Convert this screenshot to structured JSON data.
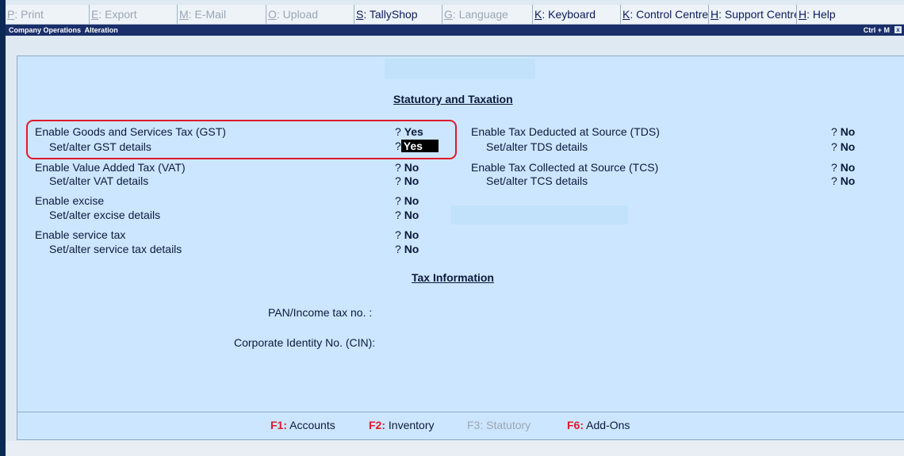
{
  "menu": [
    {
      "key": "P",
      "label": ": Print",
      "active": false
    },
    {
      "key": "E",
      "label": ": Export",
      "active": false
    },
    {
      "key": "M",
      "label": ": E-Mail",
      "active": false
    },
    {
      "key": "O",
      "label": ": Upload",
      "active": false
    },
    {
      "key": "S",
      "label": ": TallyShop",
      "active": true
    },
    {
      "key": "G",
      "label": ": Language",
      "active": false
    },
    {
      "key": "K",
      "label": ": Keyboard",
      "active": true
    },
    {
      "key": "K",
      "label": ": Control Centre",
      "active": true
    },
    {
      "key": "H",
      "label": ": Support Centre",
      "active": true
    },
    {
      "key": "H",
      "label": ": Help",
      "active": true
    }
  ],
  "title": {
    "text": "Company Operations  Alteration",
    "shortcut": "Ctrl + M",
    "close": "x"
  },
  "statutory": {
    "heading": "Statutory and Taxation",
    "left": [
      {
        "label": "Enable Goods and Services Tax (GST)",
        "q": "?",
        "value": "Yes"
      },
      {
        "label": "Set/alter GST details",
        "q": "?",
        "value": "Yes"
      },
      {
        "label": "Enable Value Added Tax (VAT)",
        "q": "?",
        "value": "No"
      },
      {
        "label": "Set/alter VAT details",
        "q": "?",
        "value": "No"
      },
      {
        "label": "Enable excise",
        "q": "?",
        "value": "No"
      },
      {
        "label": "Set/alter excise details",
        "q": "?",
        "value": "No"
      },
      {
        "label": "Enable service tax",
        "q": "?",
        "value": "No"
      },
      {
        "label": "Set/alter service tax details",
        "q": "?",
        "value": "No"
      }
    ],
    "right": [
      {
        "label": "Enable Tax Deducted at Source (TDS)",
        "q": "?",
        "value": "No"
      },
      {
        "label": "Set/alter TDS details",
        "q": "?",
        "value": "No"
      },
      {
        "label": "Enable Tax Collected at Source (TCS)",
        "q": "?",
        "value": "No"
      },
      {
        "label": "Set/alter TCS details",
        "q": "?",
        "value": "No"
      }
    ]
  },
  "tax_info": {
    "heading": "Tax Information",
    "pan_label": "PAN/Income tax no. :",
    "pan_value": "",
    "cin_label": "Corporate Identity No. (CIN):",
    "cin_value": ""
  },
  "footer": [
    {
      "key": "F1:",
      "label": "Accounts",
      "disabled": false
    },
    {
      "key": "F2:",
      "label": "Inventory",
      "disabled": false
    },
    {
      "key": "F3:",
      "label": "Statutory",
      "disabled": true
    },
    {
      "key": "F6:",
      "label": "Add-Ons",
      "disabled": false
    }
  ],
  "colors": {
    "panel": "#cde6ff",
    "title_bar": "#1a2f6a",
    "highlight_border": "#e0192b",
    "fkey": "#e0192b"
  }
}
